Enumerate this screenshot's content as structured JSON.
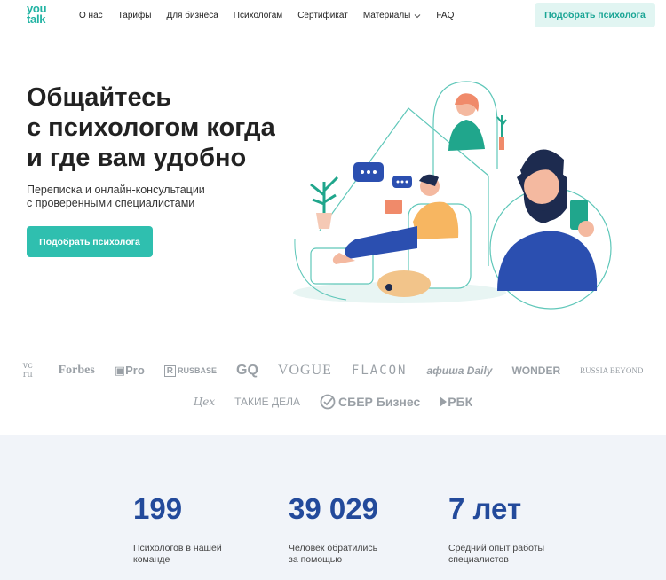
{
  "header": {
    "logo": [
      "you",
      "talk"
    ],
    "nav": [
      "О нас",
      "Тарифы",
      "Для бизнеса",
      "Психологам",
      "Сертификат",
      "Материалы",
      "FAQ"
    ],
    "cta": "Подобрать психолога"
  },
  "hero": {
    "title_lines": [
      "Общайтесь",
      "с психологом когда",
      "и где вам удобно"
    ],
    "subtitle_lines": [
      "Переписка и онлайн-консультации",
      "с проверенными специалистами"
    ],
    "cta": "Подобрать психолога"
  },
  "press_logos": {
    "row1": [
      "vc ru",
      "Forbes",
      "Pro",
      "RUSBASE",
      "GQ",
      "VOGUE",
      "FLACON",
      "афиша Daily",
      "WONDER",
      "RUSSIA BEYOND"
    ],
    "row2": [
      "Цех",
      "ТАКИЕ ДЕЛА",
      "СБЕР Бизнес",
      "РБК"
    ]
  },
  "stats": [
    {
      "value": "199",
      "label_lines": [
        "Психологов в нашей",
        "команде"
      ]
    },
    {
      "value": "39 029",
      "label_lines": [
        "Человек обратились",
        "за помощью"
      ]
    },
    {
      "value": "7 лет",
      "label_lines": [
        "Средний опыт работы",
        "специалистов"
      ]
    }
  ],
  "colors": {
    "accent": "#2fbfaf",
    "accent_light": "#e1f5f2",
    "stat_blue": "#234a9b",
    "stats_bg": "#f1f4f9",
    "logo_gray": "#9aa0a6"
  },
  "icons": [
    "chevron-down-icon",
    "sber-check-icon",
    "rbk-mark-icon",
    "hero-illustration"
  ]
}
